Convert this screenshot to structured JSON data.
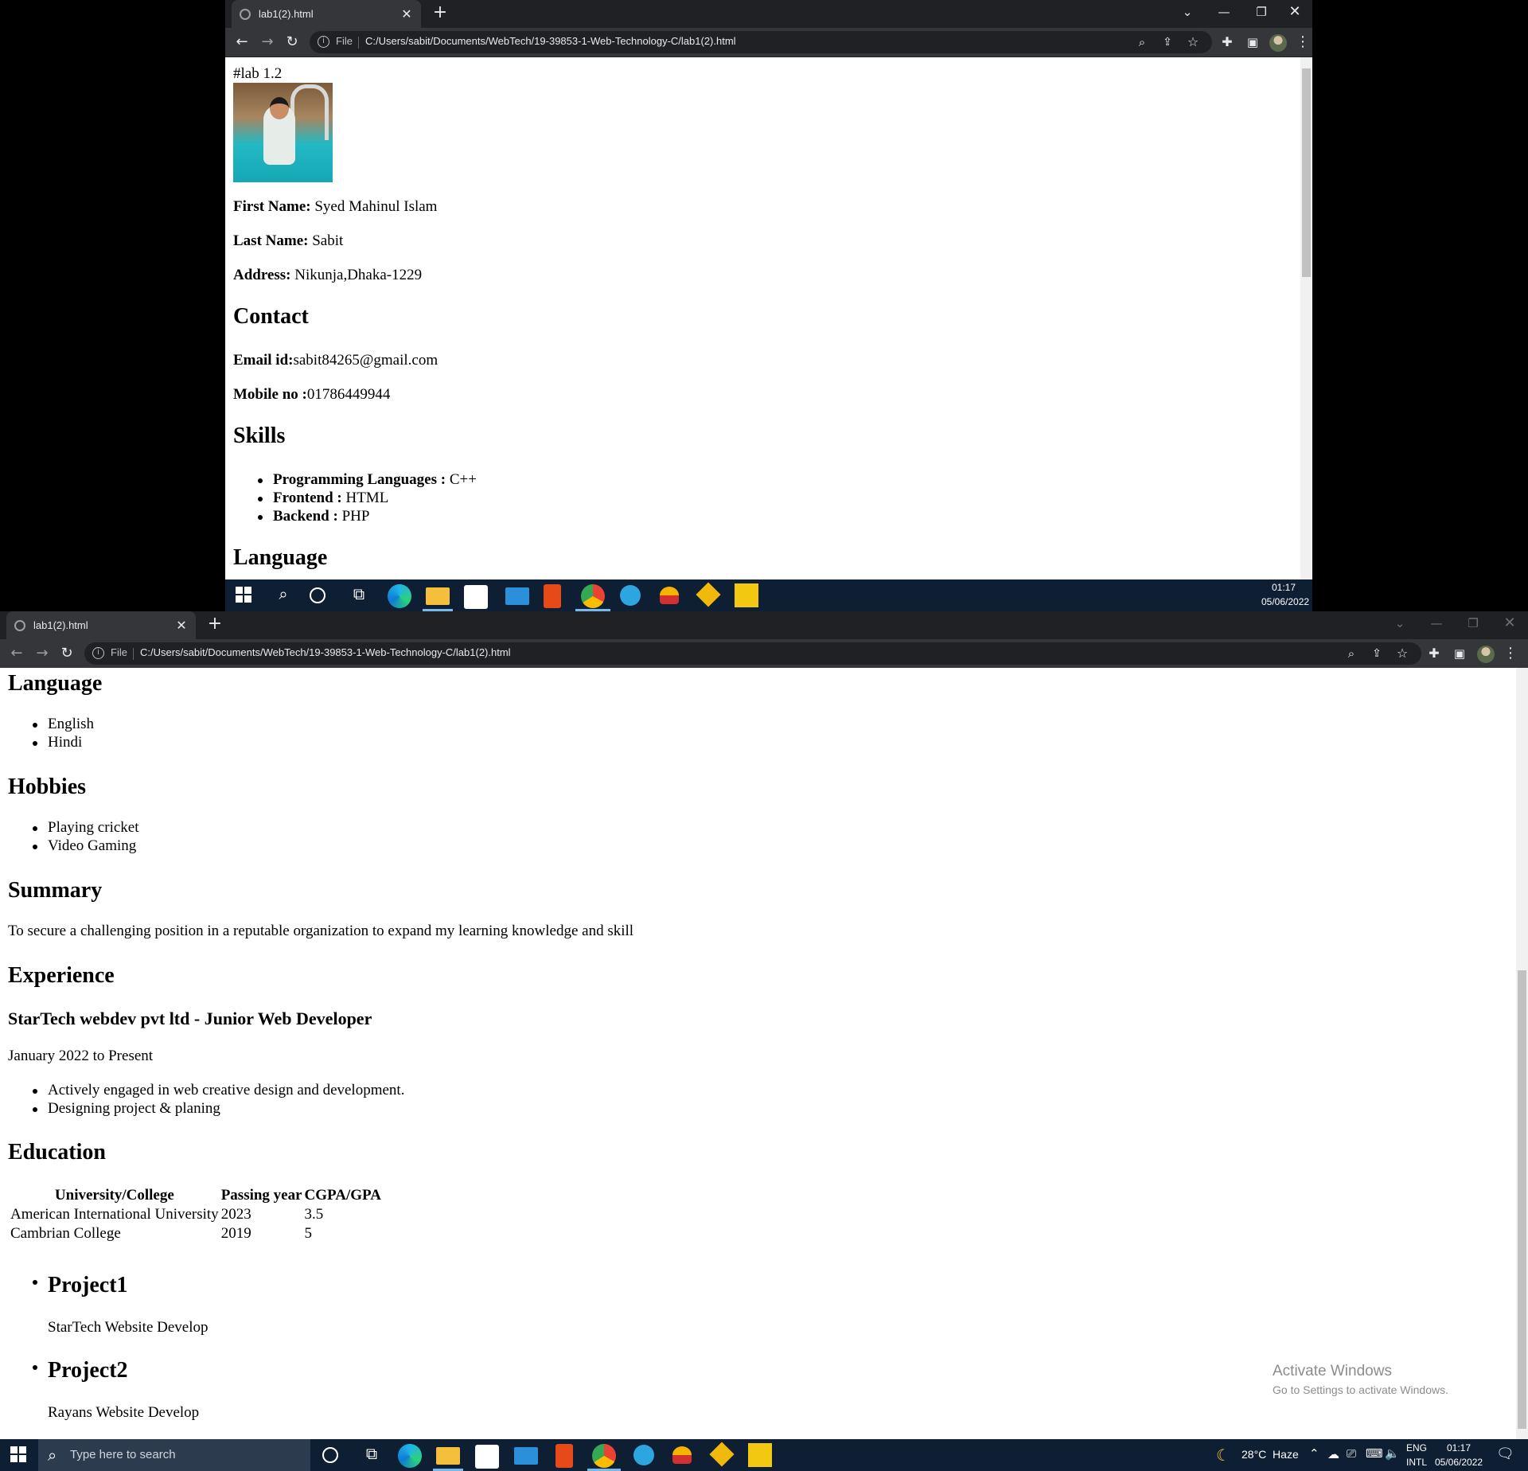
{
  "browser": {
    "tab_title": "lab1(2).html",
    "url_scheme": "File",
    "url": "C:/Users/sabit/Documents/WebTech/19-39853-1-Web-Technology-C/lab1(2).html"
  },
  "top_page": {
    "heading_text": "#lab 1.2",
    "first_name_label": "First Name:",
    "first_name": " Syed Mahinul Islam",
    "last_name_label": "Last Name:",
    "last_name": " Sabit",
    "address_label": "Address:",
    "address": " Nikunja,Dhaka-1229",
    "contact_heading": "Contact",
    "email_label": "Email id:",
    "email": "sabit84265@gmail.com",
    "mobile_label": "Mobile no :",
    "mobile": "01786449944",
    "skills_heading": "Skills",
    "skills": [
      {
        "label": "Programming Languages :",
        "value": " C++"
      },
      {
        "label": "Frontend :",
        "value": " HTML"
      },
      {
        "label": "Backend :",
        "value": " PHP"
      }
    ],
    "language_heading": "Language"
  },
  "bottom_page": {
    "language_heading": "Language",
    "languages": [
      "English",
      "Hindi"
    ],
    "hobbies_heading": "Hobbies",
    "hobbies": [
      "Playing cricket",
      "Video Gaming"
    ],
    "summary_heading": "Summary",
    "summary": "To secure a challenging position in a reputable organization to expand my learning knowledge and skill",
    "experience_heading": "Experience",
    "job_title": "StarTech webdev pvt ltd - Junior Web Developer",
    "job_period": "January 2022 to Present",
    "job_duties": [
      "Actively engaged in web creative design and development.",
      "Designing project & planing"
    ],
    "education_heading": "Education",
    "education_table": {
      "headers": [
        "University/College",
        "Passing year",
        "CGPA/GPA"
      ],
      "rows": [
        [
          "American International University",
          "2023",
          "3.5"
        ],
        [
          "Cambrian College",
          "2019",
          "5"
        ]
      ]
    },
    "projects": [
      {
        "title": "Project1",
        "desc": "StarTech Website Develop"
      },
      {
        "title": "Project2",
        "desc": "Rayans Website Develop"
      }
    ]
  },
  "taskbar_top": {
    "time": "01:17",
    "date": "05/06/2022"
  },
  "taskbar_bottom": {
    "search_placeholder": "Type here to search",
    "weather": "28°C  Haze",
    "lang1": "ENG",
    "lang2": "INTL",
    "time": "01:17",
    "date": "05/06/2022"
  },
  "watermark": {
    "line1": "Activate Windows",
    "line2": "Go to Settings to activate Windows."
  }
}
